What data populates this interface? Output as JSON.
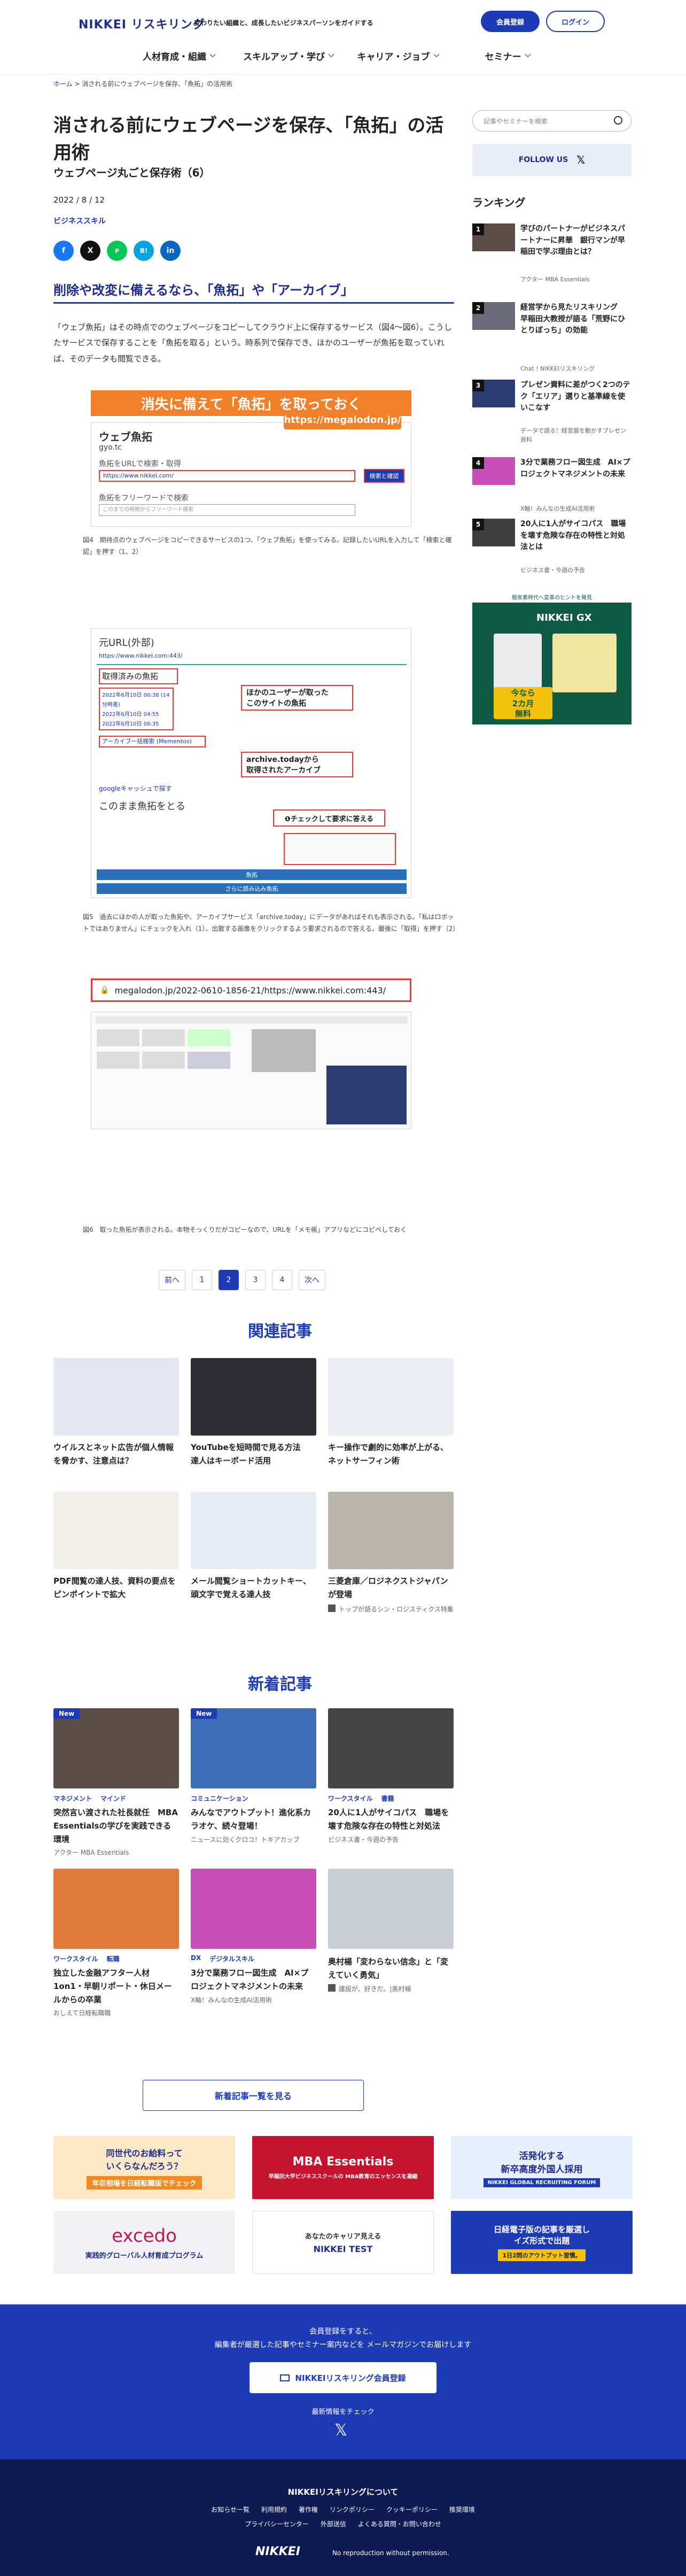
{
  "header": {
    "logo_nikkei": "NIKKEI",
    "logo_reskilling": "リスキリング",
    "tagline": "変わりたい組織と、成長したいビジネスパーソンをガイドする",
    "register": "会員登録",
    "login": "ログイン",
    "nav": [
      "人材育成・組織",
      "スキルアップ・学び",
      "キャリア・ジョブ",
      "セミナー"
    ]
  },
  "breadcrumb": {
    "home": "ホーム",
    "sep": ">",
    "current": "消される前にウェブページを保存、「魚拓」の活用術"
  },
  "article": {
    "title": "消される前にウェブページを保存、「魚拓」の活用術",
    "subtitle": "ウェブページ丸ごと保存術（6）",
    "date": "2022 / 8 / 12",
    "category": "ビジネススキル",
    "share": [
      "f",
      "X",
      "P",
      "B!",
      "in"
    ],
    "heading": "削除や改変に備えるなら、「魚拓」や「アーカイブ」",
    "paragraph": "「ウェブ魚拓」はその時点でのウェブページをコピーしてクラウド上に保存するサービス（図4〜図6）。こうしたサービスで保存することを「魚拓を取る」という。時系列で保存でき、ほかのユーザーが魚拓を取っていれば、そのデータも閲覧できる。",
    "fig4": {
      "banner": "消失に備えて「魚拓」を取っておく",
      "site": "ウェブ魚拓",
      "domain": "gyo.tc",
      "url_badge": "https://megalodon.jp/",
      "form1": "魚拓をURLで検索・取得",
      "input_url": "https://www.nikkei.com/",
      "btn": "検索と確認",
      "form2": "魚拓をフリーワードで検索",
      "input_word": "このまでの時期からフリーワード検索",
      "caption": "図4　期待点のウェブページをコピーできるサービスの1つ、「ウェブ魚拓」を使ってみる。記録したいURLを入力して「検索と確認」を押す（1、2）"
    },
    "fig5": {
      "label": "元URL(外部)",
      "url": "https://www.nikkei.com:443/",
      "taken": "取得済みの魚拓",
      "dates": [
        "2022年6月10日 00:38 (14分時差)",
        "2022年6月10日 04:55",
        "2022年6月10日 06:35"
      ],
      "note1": "ほかのユーザーが取った\nこのサイトの魚拓",
      "archive": "アーカイブ一括検索 (Mementos)",
      "note2": "archive.todayから\n取得されたアーカイブ",
      "google": "googleキャッシュで探す",
      "save": "このまま魚拓をとる",
      "check": "❶チェックして要求に答える",
      "btn1": "魚拓",
      "btn2": "さらに読み込み魚拓",
      "caption": "図5　過去にほかの人が取った魚拓や、アーカイブサービス「archive.today」にデータがあればそれも表示される。「私はロボットではありません」にチェックを入れ（1）、出散する画像をクリックするよう要求されるので答える。最後に「取得」を押す（2）"
    },
    "fig6": {
      "url": "megalodon.jp/2022-0610-1856-21/https://www.nikkei.com:443/",
      "caption": "図6　取った魚拓が表示される。本物そっくりだがコピーなので、URLを「メモ帳」アプリなどにコピペしておく"
    },
    "pager": {
      "prev": "前へ",
      "pages": [
        "1",
        "2",
        "3",
        "4"
      ],
      "current": "2",
      "next": "次へ"
    }
  },
  "related": {
    "title": "関連記事",
    "items": [
      {
        "title": "ウイルスとネット広告が個人情報を脅かす、注意点は？",
        "meta": ""
      },
      {
        "title": "YouTubeを短時間で見る方法　達人はキーボード活用",
        "meta": ""
      },
      {
        "title": "キー操作で劇的に効率が上がる、ネットサーフィン術",
        "meta": ""
      },
      {
        "title": "PDF閲覧の達人技、資料の要点をピンポイントで拡大",
        "meta": ""
      },
      {
        "title": "メール閲覧ショートカットキー、頭文字で覚える達人技",
        "meta": ""
      },
      {
        "title": "三菱倉庫／ロジネクストジャパンが登場",
        "meta": "トップが語るシン・ロジスティクス特集"
      }
    ]
  },
  "latest": {
    "title": "新着記事",
    "items": [
      {
        "new": "New",
        "tags": [
          "マネジメント",
          "マインド"
        ],
        "title": "突然言い渡された社長就任　MBA Essentialsの学びを実践できる環境",
        "meta": "アクター MBA Essentials"
      },
      {
        "new": "New",
        "tags": [
          "コミュニケーション"
        ],
        "title": "みんなでアウトプット！進化系カラオケ、続々登場！",
        "meta": "ニュースに効くクロコ！トキアカップ"
      },
      {
        "new": "",
        "tags": [
          "ワークスタイル",
          "書籍"
        ],
        "title": "20人に1人がサイコパス　職場を壊す危険な存在の特性と対処法",
        "meta": "ビジネス書・今週の予告"
      },
      {
        "new": "",
        "tags": [
          "ワークスタイル",
          "転職"
        ],
        "title": "独立した金融アフター人材　1on1・早朝リポート・休日メールからの卒業",
        "meta": "おしえて日経転職職"
      },
      {
        "new": "",
        "tags": [
          "DX",
          "デジタルスキル"
        ],
        "title": "3分で業務フロー図生成　AI×プロジェクトマネジメントの未来",
        "meta": "X軸！みんなの生成AI活用術"
      },
      {
        "new": "",
        "tags": [],
        "title": "奥村楊「変わらない信念」と「変えていく勇気」",
        "meta": "建設が、好きだ。|奥村楊"
      }
    ],
    "more": "新着記事一覧を見る"
  },
  "banners": [
    {
      "text": "同世代のお給料って\nいくらなんだろう？",
      "sub": "年収相場を日経転職版でチェック",
      "color": "#fde8c8"
    },
    {
      "text": "MBA Essentials",
      "sub": "早稲田大学ビジネススクールの MBA教育のエッセンスを凝縮",
      "color": "#c4122f"
    },
    {
      "text": "活発化する\n新卒高度外国人採用",
      "sub": "NIKKEI GLOBAL RECRUITING FORUM",
      "color": "#e7f0fa"
    },
    {
      "text": "excedo",
      "sub": "実践的グローバル人材育成プログラム",
      "color": "#f2f2f5"
    },
    {
      "text": "あなたのキャリア見える",
      "sub": "NIKKEI TEST",
      "color": "#ffffff"
    },
    {
      "text": "日経電子版の記事を厳選し\nイズ形式で出題",
      "sub": "1日2問のアウトプット習慣。",
      "color": "#1d3bb5"
    }
  ],
  "sidebar": {
    "search": "記事やセミナーを検索",
    "follow": "FOLLOW US",
    "ranking_title": "ランキング",
    "ranking": [
      {
        "n": "1",
        "title": "学びのパートナーがビジネスパートナーに昇華　銀行マンが早稲田で学ぶ理由とは？",
        "meta": "アクター MBA Essentials"
      },
      {
        "n": "2",
        "title": "経営学から見たリスキリング　早稲田大教授が語る「荒野にひとりぼっち」の効能",
        "meta": "Chat ! NIKKEIリスキリング"
      },
      {
        "n": "3",
        "title": "プレゼン資料に差がつく2つのテク「エリア」選りと基準線を使いこなす",
        "meta": "データで語る！経営層を動かすプレゼン資料"
      },
      {
        "n": "4",
        "title": "3分で業務フロー図生成　AI×プロジェクトマネジメントの未来",
        "meta": "X軸！みんなの生成AI活用術"
      },
      {
        "n": "5",
        "title": "20人に1人がサイコパス　職場を壊す危険な存在の特性と対処法とは",
        "meta": "ビジネス書・今週の予告"
      }
    ],
    "ad": {
      "top": "脱炭素時代へ変革のヒントを発見",
      "brand": "NIKKEI GX",
      "promo": "今なら\n2カ月\n無料"
    }
  },
  "footer": {
    "cta1": "会員登録をすると、",
    "cta2": "編集者が厳選した記事やセミナー案内などを メールマガジンでお届けします",
    "btn": "NIKKEIリスキリング会員登録",
    "latest": "最新情報をチェック",
    "about": "NIKKEIリスキリングについて",
    "links1": [
      "お知らせ一覧",
      "利用規約",
      "著作権",
      "リンクポリシー",
      "クッキーポリシー",
      "推奨環境"
    ],
    "links2": [
      "プライバシーセンター",
      "外部送信",
      "よくある質問・お問い合わせ"
    ],
    "brand": "NIKKEI",
    "copyright": "No reproduction without permission."
  }
}
